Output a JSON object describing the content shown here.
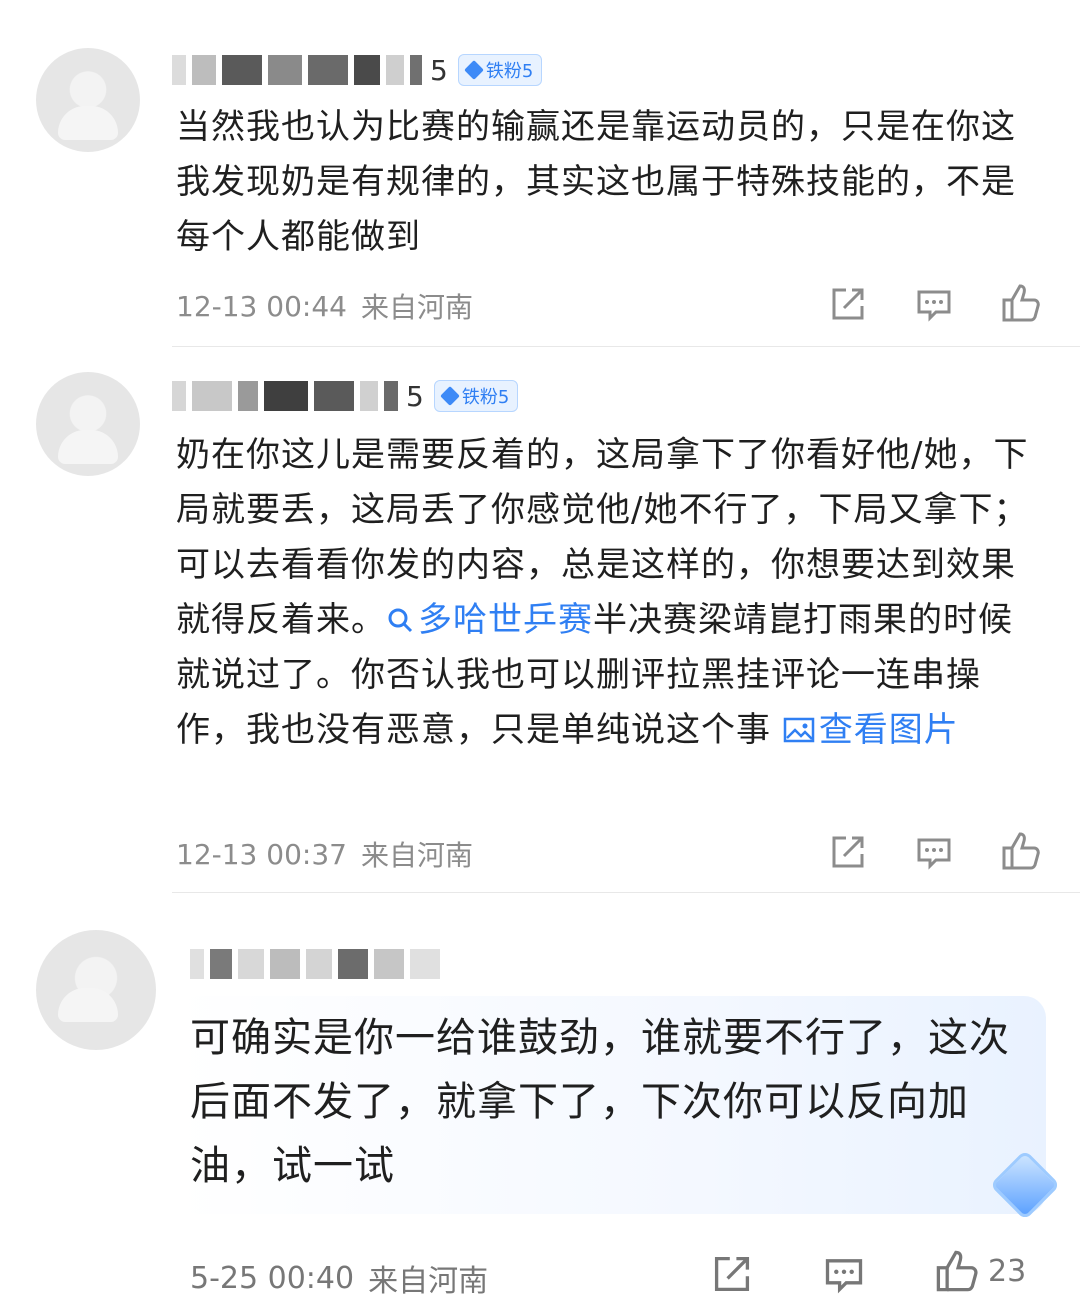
{
  "comments": [
    {
      "level": "5",
      "badge": "铁粉5",
      "text": "当然我也认为比赛的输赢还是靠运动员的，只是在你这我发现奶是有规律的，其实这也属于特殊技能的，不是每个人都能做到",
      "time": "12-13 00:44",
      "location": "来自河南",
      "actions": {
        "share_icon": "share-icon",
        "comment_icon": "comment-icon",
        "like_icon": "like-icon"
      }
    },
    {
      "level": "5",
      "badge": "铁粉5",
      "text_before": "奶在你这儿是需要反着的，这局拿下了你看好他/她，下局就要丢，这局丢了你感觉他/她不行了，下局又拿下；可以去看看你发的内容，总是这样的，你想要达到效果就得反着来。",
      "topic_link": "多哈世乒赛",
      "text_after": "半决赛梁靖崑打雨果的时候就说过了。你否认我也可以删评拉黑挂评论一连串操作，我也没有恶意，只是单纯说这个事",
      "image_link": "查看图片",
      "time": "12-13 00:37",
      "location": "来自河南"
    },
    {
      "text": "可确实是你一给谁鼓劲，谁就要不行了，这次后面不发了，就拿下了，下次你可以反向加油，试一试",
      "time": "5-25 00:40",
      "location": "来自河南",
      "likes": "23"
    }
  ],
  "colors": {
    "link": "#2f7ff3",
    "meta": "#8c8c8c",
    "text": "#1f1f1f"
  }
}
